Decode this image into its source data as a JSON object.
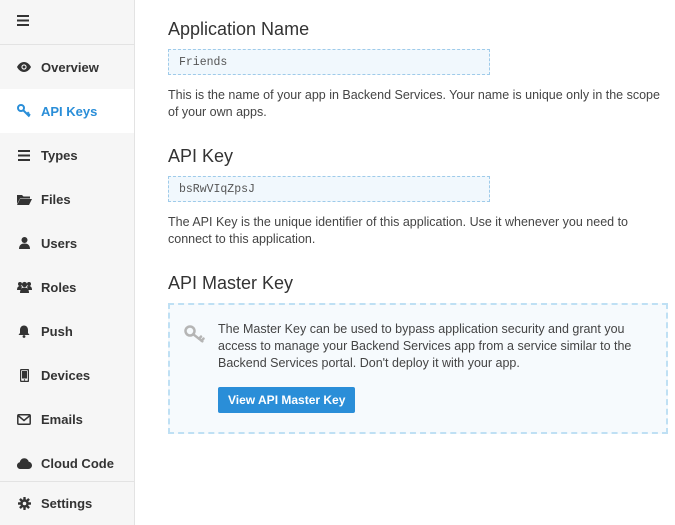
{
  "sidebar": {
    "items": [
      {
        "label": "Overview",
        "icon": "eye-icon"
      },
      {
        "label": "API Keys",
        "icon": "key-icon",
        "active": true
      },
      {
        "label": "Types",
        "icon": "list-icon"
      },
      {
        "label": "Files",
        "icon": "folder-icon"
      },
      {
        "label": "Users",
        "icon": "user-icon"
      },
      {
        "label": "Roles",
        "icon": "group-icon"
      },
      {
        "label": "Push",
        "icon": "bell-icon"
      },
      {
        "label": "Devices",
        "icon": "mobile-icon"
      },
      {
        "label": "Emails",
        "icon": "envelope-icon"
      },
      {
        "label": "Cloud Code",
        "icon": "cloud-icon"
      }
    ],
    "settings": {
      "label": "Settings",
      "icon": "gear-icon"
    }
  },
  "main": {
    "app_name": {
      "title": "Application Name",
      "value": "Friends",
      "description": "This is the name of your app in Backend Services. Your name is unique only in the scope of your own apps."
    },
    "api_key": {
      "title": "API Key",
      "value": "bsRwVIqZpsJ",
      "description": "The API Key is the unique identifier of this application. Use it whenever you need to connect to this application."
    },
    "master_key": {
      "title": "API Master Key",
      "description": "The Master Key can be used to bypass application security and grant you access to manage your Backend Services app from a service similar to the Backend Services portal. Don't deploy it with your app.",
      "button_label": "View API Master Key"
    }
  },
  "colors": {
    "accent": "#2a8ed8",
    "sidebar_bg": "#f6f6f6",
    "field_border": "#9fcbea"
  }
}
